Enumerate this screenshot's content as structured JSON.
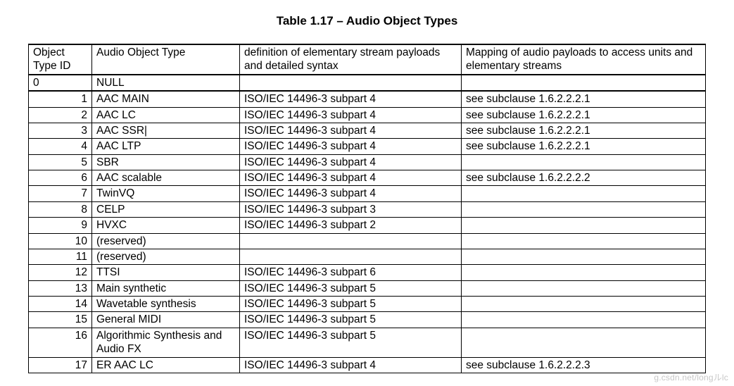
{
  "title": "Table 1.17 – Audio Object Types",
  "headers": {
    "col1": "Object Type ID",
    "col2": "Audio Object Type",
    "col3": "definition of elementary stream payloads and detailed syntax",
    "col4": "Mapping of audio payloads to access units and elementary streams"
  },
  "rows": [
    {
      "id": "0",
      "type": "NULL",
      "def": "",
      "map": ""
    },
    {
      "id": "1",
      "type": "AAC MAIN",
      "def": "ISO/IEC 14496-3 subpart 4",
      "map": "see subclause 1.6.2.2.2.1"
    },
    {
      "id": "2",
      "type": "AAC LC",
      "def": "ISO/IEC 14496-3 subpart 4",
      "map": "see subclause 1.6.2.2.2.1"
    },
    {
      "id": "3",
      "type": "AAC SSR|",
      "def": "ISO/IEC 14496-3 subpart 4",
      "map": "see subclause 1.6.2.2.2.1"
    },
    {
      "id": "4",
      "type": "AAC LTP",
      "def": "ISO/IEC 14496-3 subpart 4",
      "map": "see subclause 1.6.2.2.2.1"
    },
    {
      "id": "5",
      "type": "SBR",
      "def": "ISO/IEC 14496-3 subpart 4",
      "map": ""
    },
    {
      "id": "6",
      "type": "AAC scalable",
      "def": "ISO/IEC 14496-3 subpart 4",
      "map": "see subclause 1.6.2.2.2.2"
    },
    {
      "id": "7",
      "type": "TwinVQ",
      "def": "ISO/IEC 14496-3 subpart 4",
      "map": ""
    },
    {
      "id": "8",
      "type": "CELP",
      "def": "ISO/IEC 14496-3 subpart 3",
      "map": ""
    },
    {
      "id": "9",
      "type": "HVXC",
      "def": "ISO/IEC 14496-3 subpart 2",
      "map": ""
    },
    {
      "id": "10",
      "type": "(reserved)",
      "def": "",
      "map": ""
    },
    {
      "id": "11",
      "type": "(reserved)",
      "def": "",
      "map": ""
    },
    {
      "id": "12",
      "type": "TTSI",
      "def": "ISO/IEC 14496-3 subpart 6",
      "map": ""
    },
    {
      "id": "13",
      "type": "Main synthetic",
      "def": "ISO/IEC 14496-3 subpart 5",
      "map": ""
    },
    {
      "id": "14",
      "type": "Wavetable synthesis",
      "def": "ISO/IEC 14496-3 subpart 5",
      "map": ""
    },
    {
      "id": "15",
      "type": "General MIDI",
      "def": "ISO/IEC 14496-3 subpart 5",
      "map": ""
    },
    {
      "id": "16",
      "type": "Algorithmic Synthesis and Audio FX",
      "def": "ISO/IEC 14496-3 subpart 5",
      "map": ""
    },
    {
      "id": "17",
      "type": "ER AAC LC",
      "def": "ISO/IEC 14496-3 subpart 4",
      "map": "see subclause 1.6.2.2.2.3"
    }
  ],
  "watermark": "g.csdn.net/longルlc"
}
